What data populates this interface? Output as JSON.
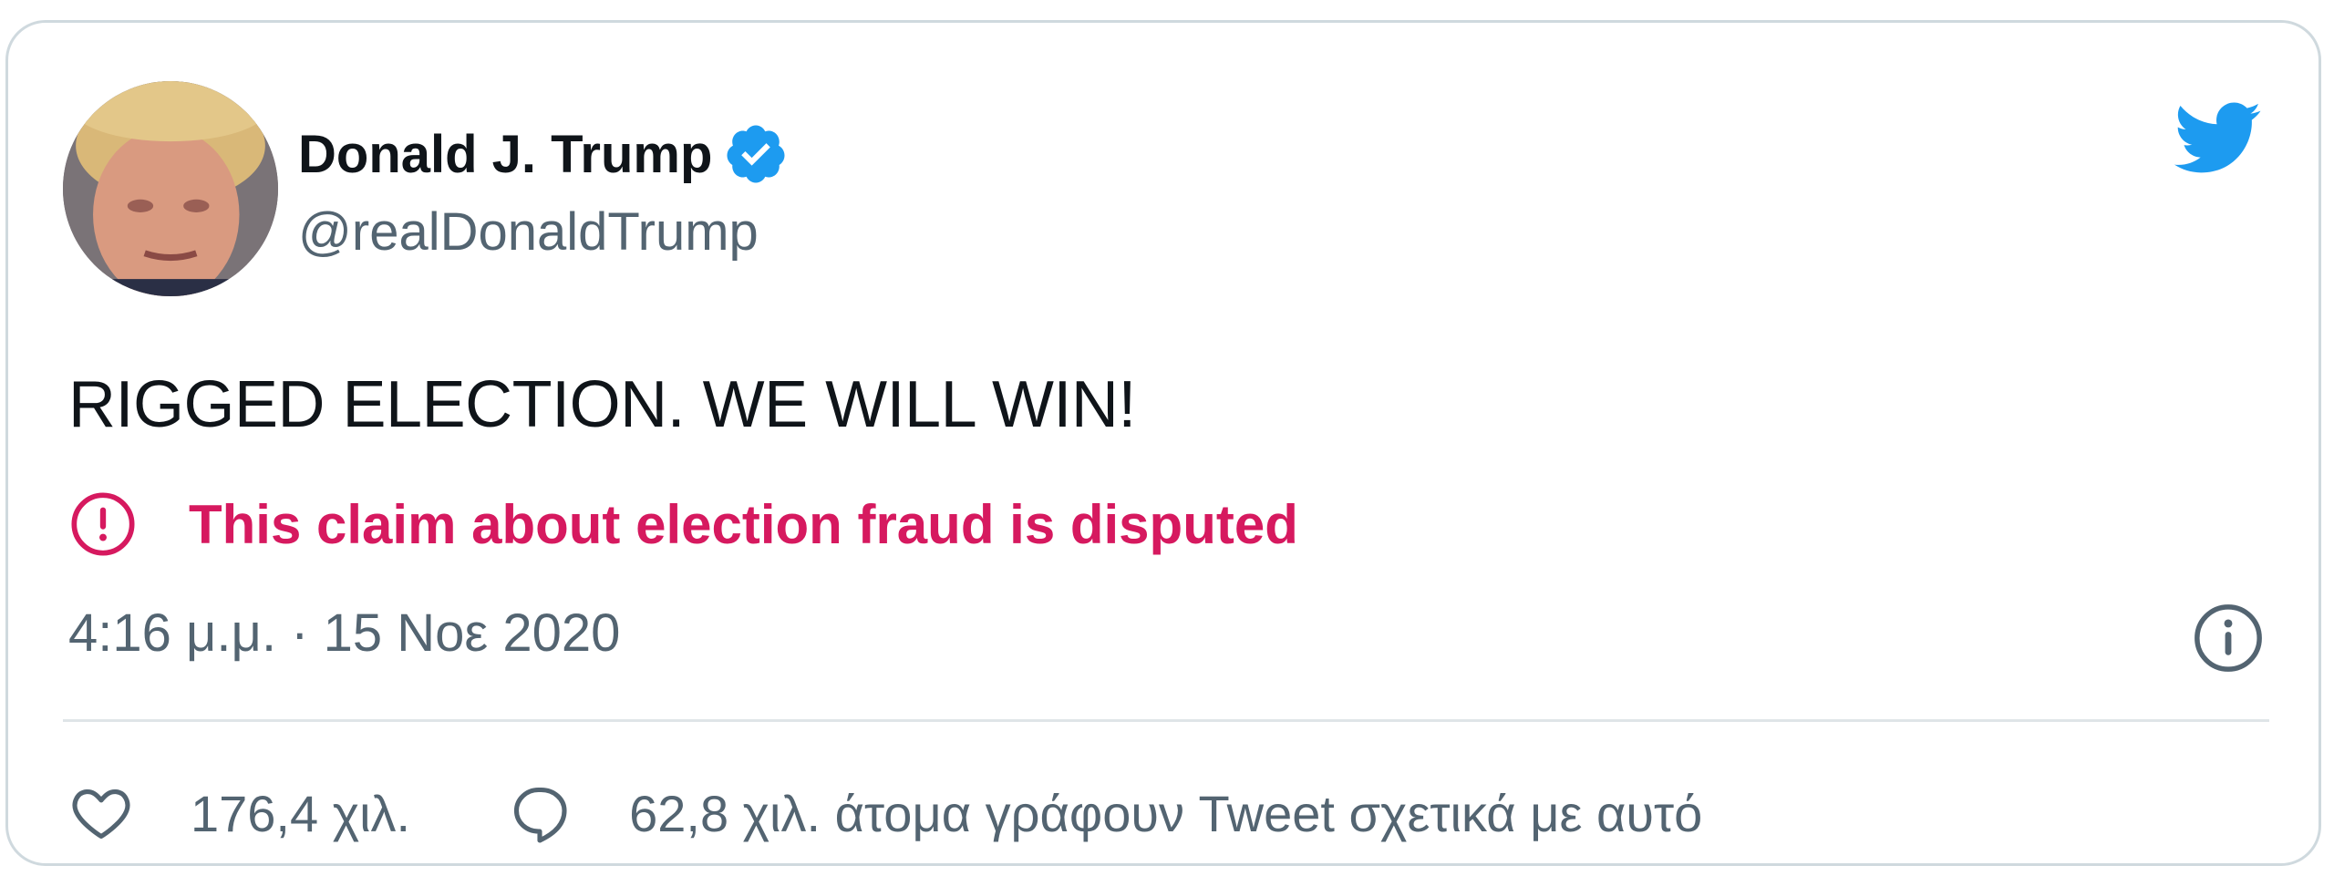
{
  "author": {
    "display_name": "Donald J. Trump",
    "handle": "@realDonaldTrump",
    "verified": true,
    "avatar_icon": "profile-photo"
  },
  "tweet": {
    "text": "RIGGED ELECTION. WE WILL WIN!",
    "warning": "This claim about election fraud is disputed",
    "timestamp": "4:16 μ.μ. · 15 Νοε 2020"
  },
  "actions": {
    "likes": "176,4 χιλ.",
    "replies": "62,8 χιλ. άτομα γράφουν Tweet σχετικά με αυτό"
  },
  "icons": {
    "brand": "twitter-bird-icon",
    "verified": "verified-badge-icon",
    "warning": "exclamation-circle-icon",
    "info": "info-icon",
    "like": "heart-icon",
    "reply": "speech-bubble-icon"
  },
  "colors": {
    "brand_blue": "#1d9bf0",
    "warning_red": "#d6195f",
    "secondary_text": "#536471",
    "border": "#cfd9de"
  }
}
